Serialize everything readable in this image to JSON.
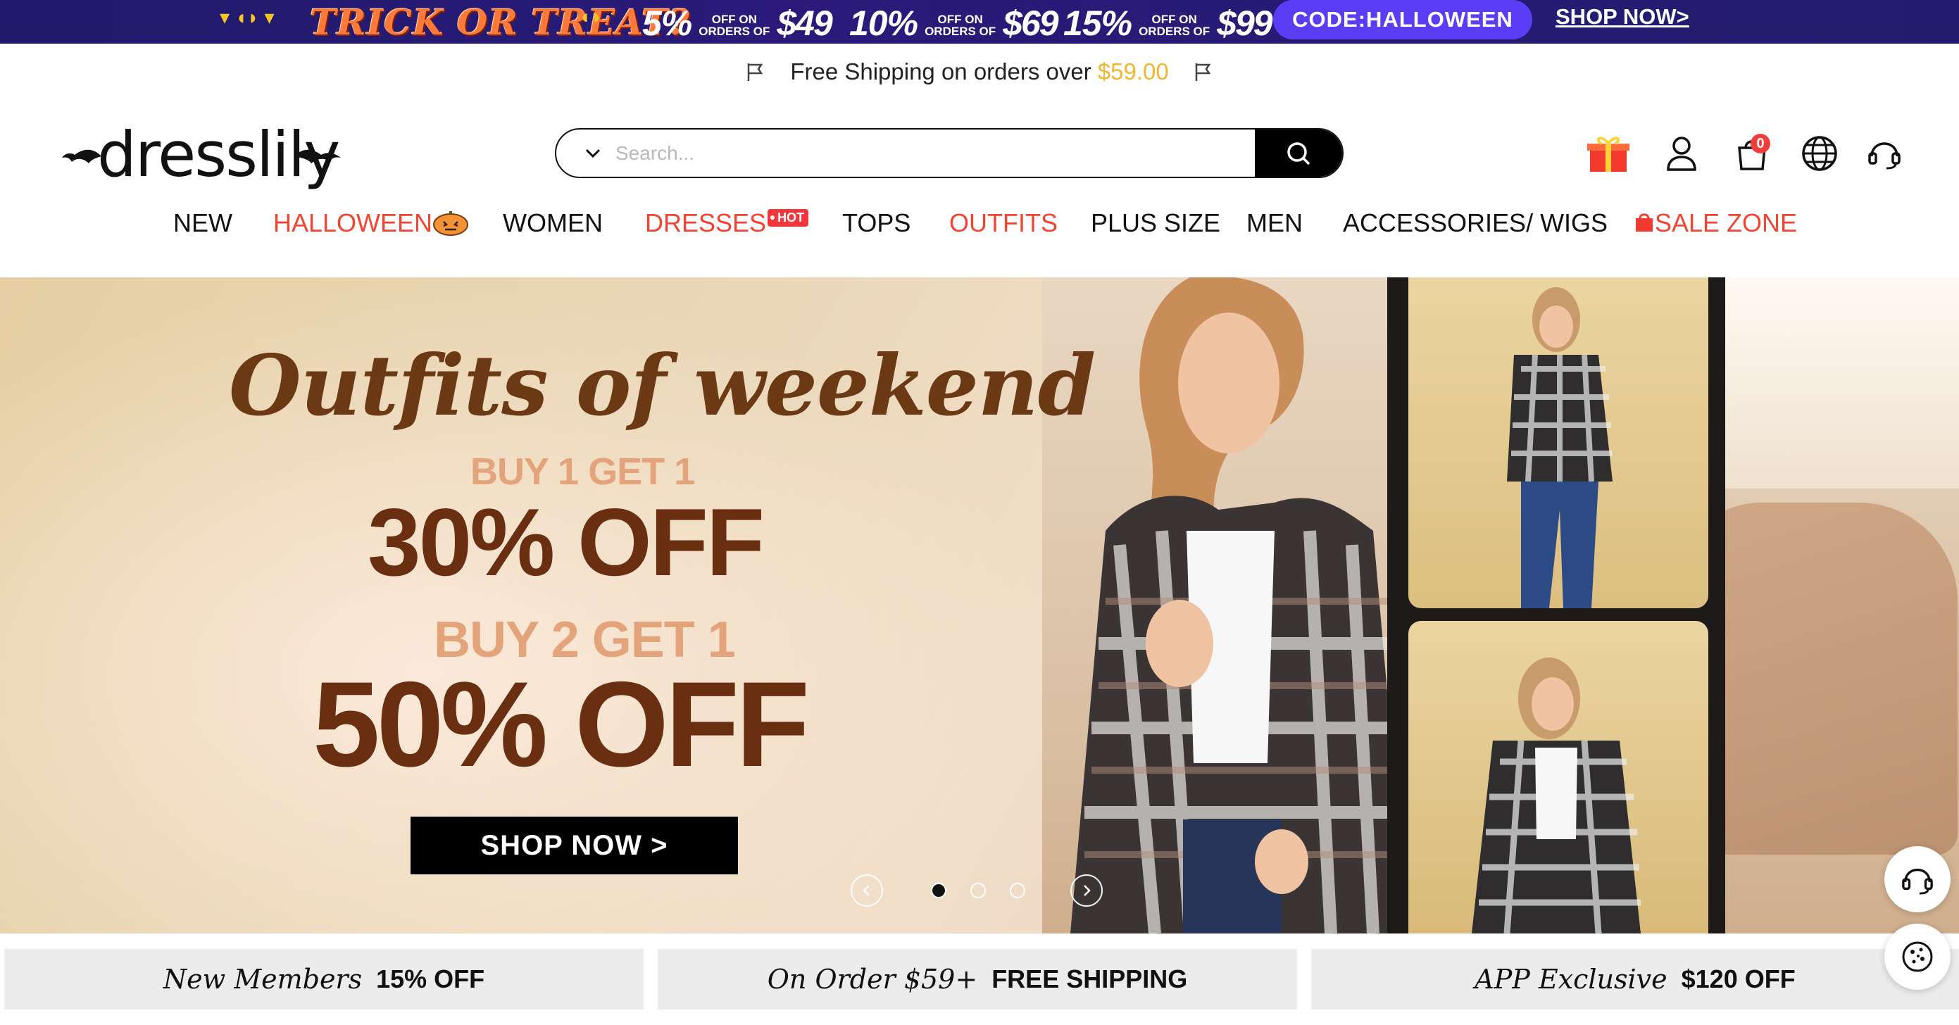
{
  "promo_bar": {
    "title": "TRICK OR TREAT?",
    "deals": [
      {
        "percent": "5%",
        "off_on": "OFF ON",
        "orders_of": "ORDERS OF",
        "amount": "$49"
      },
      {
        "percent": "10%",
        "off_on": "OFF ON",
        "orders_of": "ORDERS OF",
        "amount": "$69"
      },
      {
        "percent": "15%",
        "off_on": "OFF ON",
        "orders_of": "ORDERS OF",
        "amount": "$99"
      }
    ],
    "code": "CODE:HALLOWEEN",
    "shop_now": "SHOP NOW>"
  },
  "shipping": {
    "text": "Free Shipping on orders over",
    "amount": "$59.00"
  },
  "header": {
    "logo": "dresslily",
    "search_placeholder": "Search...",
    "cart_count": "0"
  },
  "nav": {
    "items": [
      {
        "label": "NEW"
      },
      {
        "label": "HALLOWEEN"
      },
      {
        "label": "WOMEN"
      },
      {
        "label": "DRESSES",
        "badge": "HOT"
      },
      {
        "label": "TOPS"
      },
      {
        "label": "OUTFITS"
      },
      {
        "label": "PLUS SIZE"
      },
      {
        "label": "MEN"
      },
      {
        "label": "ACCESSORIES/ WIGS"
      },
      {
        "label": "SALE ZONE"
      }
    ]
  },
  "hero": {
    "title": "Outfits of weekend",
    "line1": "BUY 1 GET 1",
    "offer1": "30% OFF",
    "line2": "BUY 2 GET 1",
    "offer2": "50% OFF",
    "cta": "SHOP NOW >",
    "slides": 3,
    "active_slide": 1
  },
  "benefits": [
    {
      "script": "New Members",
      "strong": "15% OFF"
    },
    {
      "script": "On Order $59+",
      "strong": "FREE SHIPPING"
    },
    {
      "script": "APP Exclusive",
      "strong": "$120 OFF"
    }
  ],
  "colors": {
    "promo_bg": "#231c6e",
    "code_pill": "#5b3df5",
    "nav_accent": "#f24433",
    "shipping_amount": "#f0b730",
    "hero_text": "#6a2f10",
    "hero_sub": "#e3a47c"
  }
}
